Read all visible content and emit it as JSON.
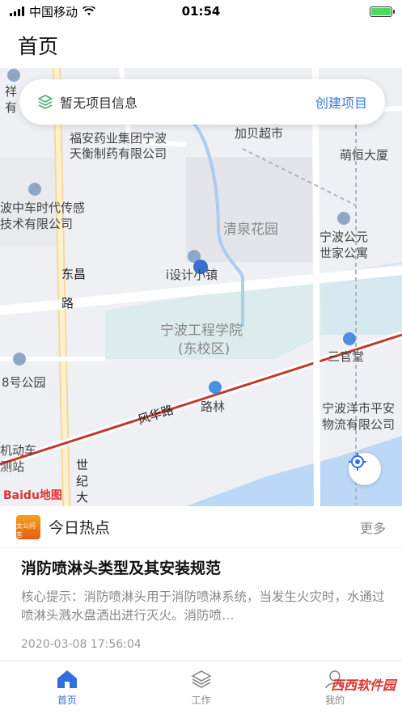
{
  "status_bar": {
    "carrier": "中国移动",
    "time": "01:54"
  },
  "page_title": "首页",
  "project_card": {
    "text": "暂无项目信息",
    "create_label": "创建项目"
  },
  "map": {
    "labels": {
      "pharma_1": "福安药业集团宁波",
      "pharma_2": "天衡制药有限公司",
      "jiabei": "加贝超市",
      "menghen": "萌恒大厦",
      "car_1": "波中车时代传感",
      "car_2": "技术有限公司",
      "qingquan": "清泉花园",
      "ningbo_gongyuan_1": "宁波公元",
      "ningbo_gongyuan_2": "世家公寓",
      "dongchang_1": "东昌",
      "dongchang_2": "路",
      "isheji": "i设计小镇",
      "nbut_1": "宁波工程学院",
      "nbut_2": "(东校区)",
      "sanguantang": "三官堂",
      "park8": "8号公园",
      "fenghua": "风华路",
      "lulin": "路林",
      "yangshi_1": "宁波洋市平安",
      "yangshi_2": "物流有限公司",
      "motor_1": "机动车",
      "motor_2": "测站",
      "shiji_1": "世",
      "shiji_2": "纪",
      "shiji_3": "大",
      "top_left_1": "祥",
      "top_left_2": "有"
    },
    "logo": "Baidu地图"
  },
  "hot": {
    "title": "今日热点",
    "more": "更多",
    "badge": "太公问答"
  },
  "article": {
    "title": "消防喷淋头类型及其安装规范",
    "summary": "核心提示：消防喷淋头用于消防喷淋系统，当发生火灾时，水通过喷淋头溅水盘洒出进行灭火。消防喷…",
    "date": "2020-03-08 17:56:04"
  },
  "tabs": [
    {
      "label": "首页"
    },
    {
      "label": "工作"
    },
    {
      "label": "我的"
    }
  ],
  "watermark": "西西软件园",
  "colors": {
    "accent": "#2f6fde",
    "road_red": "#c0392b",
    "river": "#bcd8f7"
  }
}
